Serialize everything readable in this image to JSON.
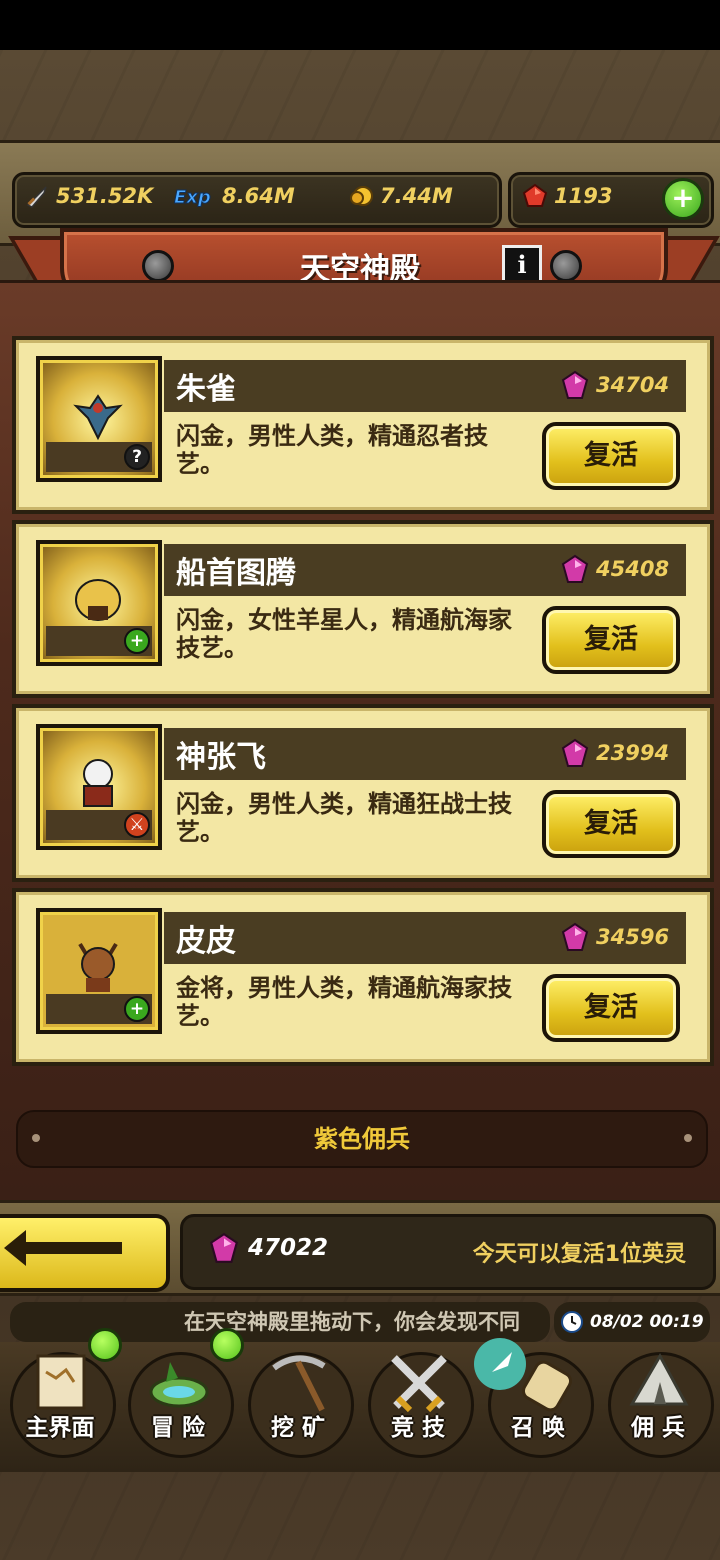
{
  "resources": {
    "attack": "531.52K",
    "exp": "8.64M",
    "gold": "7.44M",
    "rubies": "1193"
  },
  "header": {
    "title": "天空神殿"
  },
  "heroes": [
    {
      "name": "朱雀",
      "price": "34704",
      "desc": "闪金，男性人类，精通忍者技艺。",
      "badge": "?",
      "revive_label": "复活"
    },
    {
      "name": "船首图腾",
      "price": "45408",
      "desc": "闪金，女性羊星人，精通航海家技艺。",
      "badge": "+",
      "revive_label": "复活"
    },
    {
      "name": "神张飞",
      "price": "23994",
      "desc": "闪金，男性人类，精通狂战士技艺。",
      "badge": "",
      "revive_label": "复活"
    },
    {
      "name": "皮皮",
      "price": "34596",
      "desc": "金将，男性人类，精通航海家技艺。",
      "badge": "+",
      "revive_label": "复活"
    }
  ],
  "section_divider": "紫色佣兵",
  "footer": {
    "gem_total": "47022",
    "revive_note": "今天可以复活1位英灵",
    "ticker": "在天空神殿里拖动下，你会发现不同",
    "clock": "08/02 00:19"
  },
  "nav": [
    {
      "label": "主界面",
      "icon": "map-scroll-icon"
    },
    {
      "label": "冒 险",
      "icon": "island-icon"
    },
    {
      "label": "挖 矿",
      "icon": "pickaxe-icon"
    },
    {
      "label": "竞 技",
      "icon": "crossed-swords-icon"
    },
    {
      "label": "召 唤",
      "icon": "summon-scroll-icon"
    },
    {
      "label": "佣 兵",
      "icon": "tent-icon"
    }
  ],
  "colors": {
    "gold_text": "#f0d060",
    "card_bg": "#f3e7a4",
    "button_yellow": "#e2c01c"
  }
}
